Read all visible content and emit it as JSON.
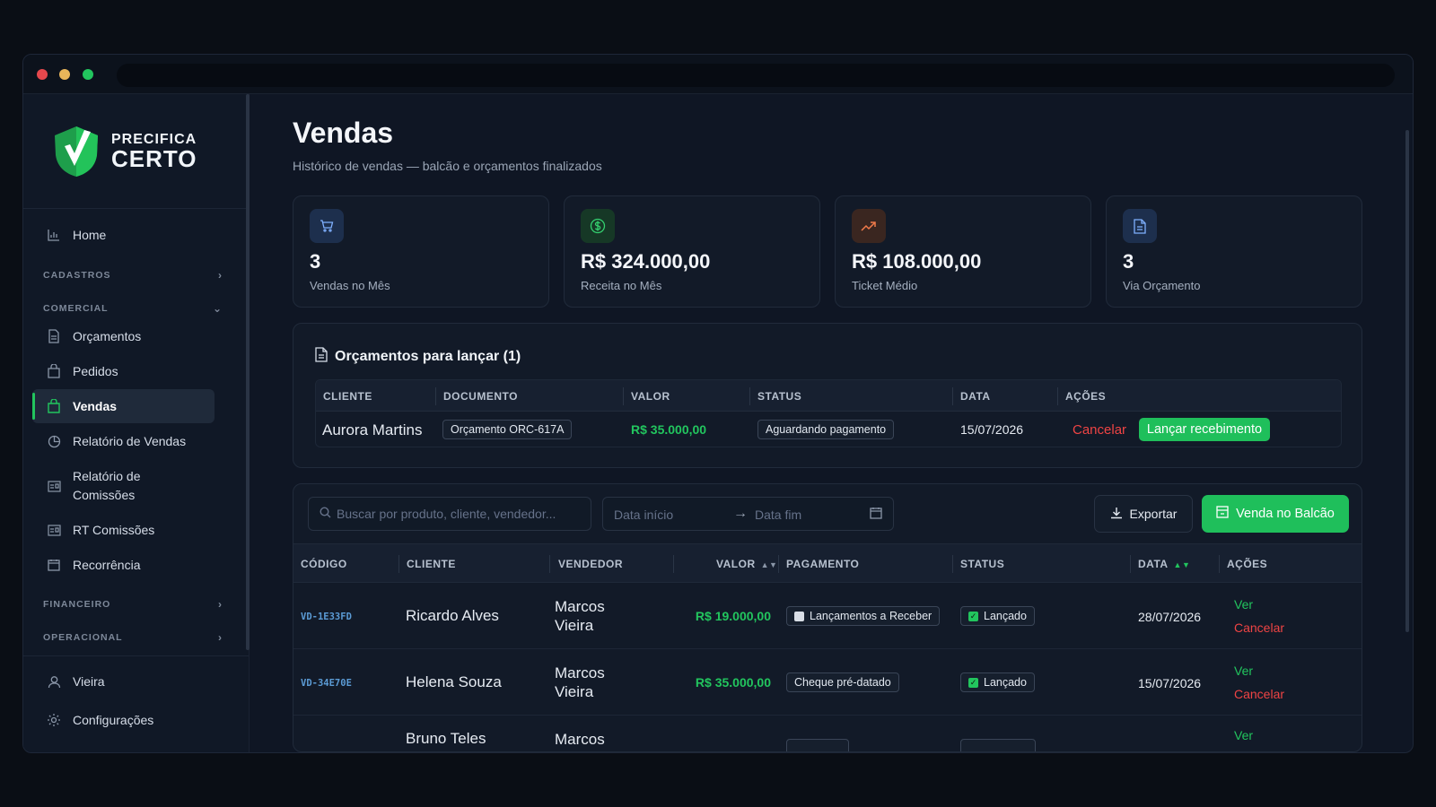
{
  "brand": {
    "line1": "PRECIFICA",
    "line2": "CERTO"
  },
  "sidebar": {
    "home": "Home",
    "sections": {
      "cadastros": "CADASTROS",
      "comercial": "COMERCIAL",
      "financeiro": "FINANCEIRO",
      "operacional": "OPERACIONAL"
    },
    "items": {
      "orcamentos": "Orçamentos",
      "pedidos": "Pedidos",
      "vendas": "Vendas",
      "relatorio_vendas": "Relatório de Vendas",
      "relatorio_comissoes_1": "Relatório de",
      "relatorio_comissoes_2": "Comissões",
      "rt_comissoes": "RT Comissões",
      "recorrencia": "Recorrência"
    },
    "user": "Vieira",
    "settings": "Configurações",
    "active": "vendas"
  },
  "page": {
    "title": "Vendas",
    "subtitle": "Histórico de vendas — balcão e orçamentos finalizados"
  },
  "stats": [
    {
      "value": "3",
      "label": "Vendas no Mês",
      "icon": "cart-icon"
    },
    {
      "value": "R$ 324.000,00",
      "label": "Receita no Mês",
      "icon": "dollar-icon"
    },
    {
      "value": "R$ 108.000,00",
      "label": "Ticket Médio",
      "icon": "trending-up-icon"
    },
    {
      "value": "3",
      "label": "Via Orçamento",
      "icon": "document-icon"
    }
  ],
  "pending": {
    "title": "Orçamentos para lançar (1)",
    "headers": {
      "cliente": "CLIENTE",
      "documento": "DOCUMENTO",
      "valor": "VALOR",
      "status": "STATUS",
      "data": "DATA",
      "acoes": "AÇÕES"
    },
    "row": {
      "cliente": "Aurora Martins",
      "documento": "Orçamento ORC-617A",
      "valor": "R$ 35.000,00",
      "status": "Aguardando pagamento",
      "data": "15/07/2026",
      "cancel": "Cancelar",
      "launch": "Lançar recebimento"
    }
  },
  "toolbar": {
    "search_placeholder": "Buscar por produto, cliente, vendedor...",
    "date_start": "Data início",
    "date_end": "Data fim",
    "export": "Exportar",
    "counter_sale": "Venda no Balcão"
  },
  "sales": {
    "headers": {
      "codigo": "CÓDIGO",
      "cliente": "CLIENTE",
      "vendedor": "VENDEDOR",
      "valor": "VALOR",
      "pagamento": "PAGAMENTO",
      "status": "STATUS",
      "data": "DATA",
      "acoes": "AÇÕES"
    },
    "rows": [
      {
        "codigo": "VD-1E33FD",
        "cliente": "Ricardo Alves",
        "vendedor1": "Marcos",
        "vendedor2": "Vieira",
        "valor": "R$ 19.000,00",
        "pagamento": "Lançamentos a Receber",
        "status": "Lançado",
        "data": "28/07/2026",
        "ver": "Ver",
        "cancel": "Cancelar"
      },
      {
        "codigo": "VD-34E70E",
        "cliente": "Helena Souza",
        "vendedor1": "Marcos",
        "vendedor2": "Vieira",
        "valor": "R$ 35.000,00",
        "pagamento": "Cheque pré-datado",
        "status": "Lançado",
        "data": "15/07/2026",
        "ver": "Ver",
        "cancel": "Cancelar"
      },
      {
        "cliente": "Bruno Teles",
        "vendedor1": "Marcos",
        "ver": "Ver"
      }
    ]
  },
  "colors": {
    "accent": "#22c55e",
    "danger": "#ef4444",
    "bg": "#0f1624",
    "card": "#121a28"
  }
}
